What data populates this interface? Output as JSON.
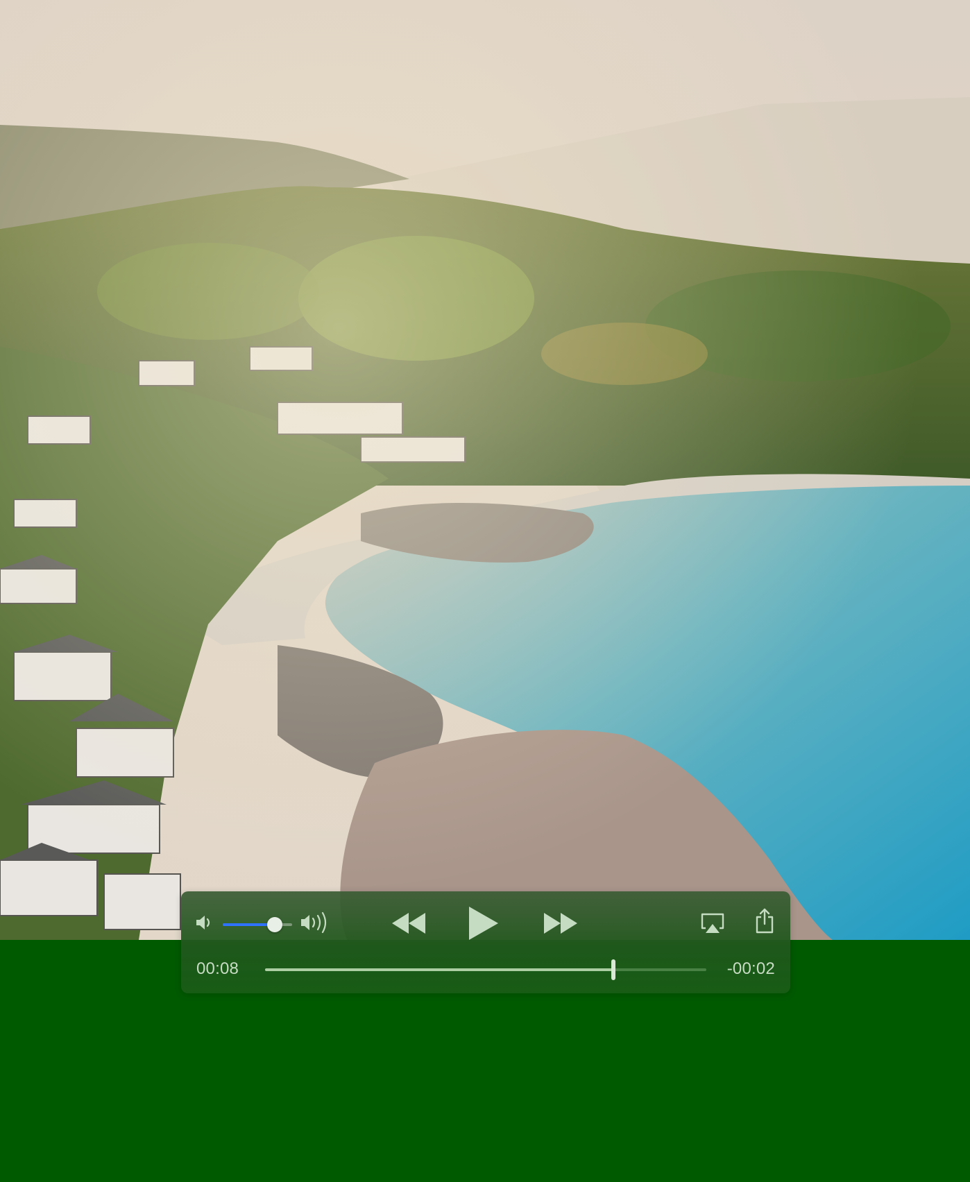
{
  "player": {
    "elapsed_time": "00:08",
    "remaining_time": "-00:02",
    "progress": 0.79,
    "volume": 0.75,
    "is_playing": false
  },
  "icons": {
    "volume_low": "speaker-low-icon",
    "volume_high": "speaker-high-icon",
    "rewind": "rewind-icon",
    "play": "play-icon",
    "fast_forward": "fast-forward-icon",
    "airplay": "airplay-icon",
    "share": "share-icon"
  },
  "colors": {
    "background": "#005a00",
    "volume_accent": "#2f72ff",
    "control_tint": "#c6dcc2"
  }
}
